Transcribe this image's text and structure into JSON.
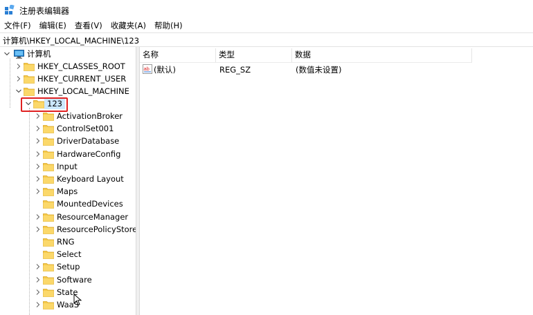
{
  "window": {
    "title": "注册表编辑器"
  },
  "menu": [
    {
      "label": "文件(F)"
    },
    {
      "label": "编辑(E)"
    },
    {
      "label": "查看(V)"
    },
    {
      "label": "收藏夹(A)"
    },
    {
      "label": "帮助(H)"
    }
  ],
  "address": "计算机\\HKEY_LOCAL_MACHINE\\123",
  "tree": {
    "root": "计算机",
    "hives": [
      "HKEY_CLASSES_ROOT",
      "HKEY_CURRENT_USER",
      "HKEY_LOCAL_MACHINE"
    ],
    "selected": "123",
    "children": [
      {
        "label": "ActivationBroker",
        "expandable": true
      },
      {
        "label": "ControlSet001",
        "expandable": true
      },
      {
        "label": "DriverDatabase",
        "expandable": true
      },
      {
        "label": "HardwareConfig",
        "expandable": true
      },
      {
        "label": "Input",
        "expandable": true
      },
      {
        "label": "Keyboard Layout",
        "expandable": true
      },
      {
        "label": "Maps",
        "expandable": true
      },
      {
        "label": "MountedDevices",
        "expandable": false
      },
      {
        "label": "ResourceManager",
        "expandable": true
      },
      {
        "label": "ResourcePolicyStore",
        "expandable": true
      },
      {
        "label": "RNG",
        "expandable": false
      },
      {
        "label": "Select",
        "expandable": false
      },
      {
        "label": "Setup",
        "expandable": true
      },
      {
        "label": "Software",
        "expandable": true
      },
      {
        "label": "State",
        "expandable": true
      },
      {
        "label": "WaaS",
        "expandable": true
      }
    ]
  },
  "list": {
    "columns": [
      "名称",
      "类型",
      "数据"
    ],
    "rows": [
      {
        "name": "(默认)",
        "type": "REG_SZ",
        "data": "(数值未设置)"
      }
    ]
  },
  "colors": {
    "folder": "#f6c94a",
    "selection": "#cce8ff",
    "highlight": "#e02020"
  },
  "icons": {
    "app": "registry-editor-icon",
    "computer": "computer-icon",
    "folder": "folder-icon",
    "string_value": "string-value-icon"
  }
}
